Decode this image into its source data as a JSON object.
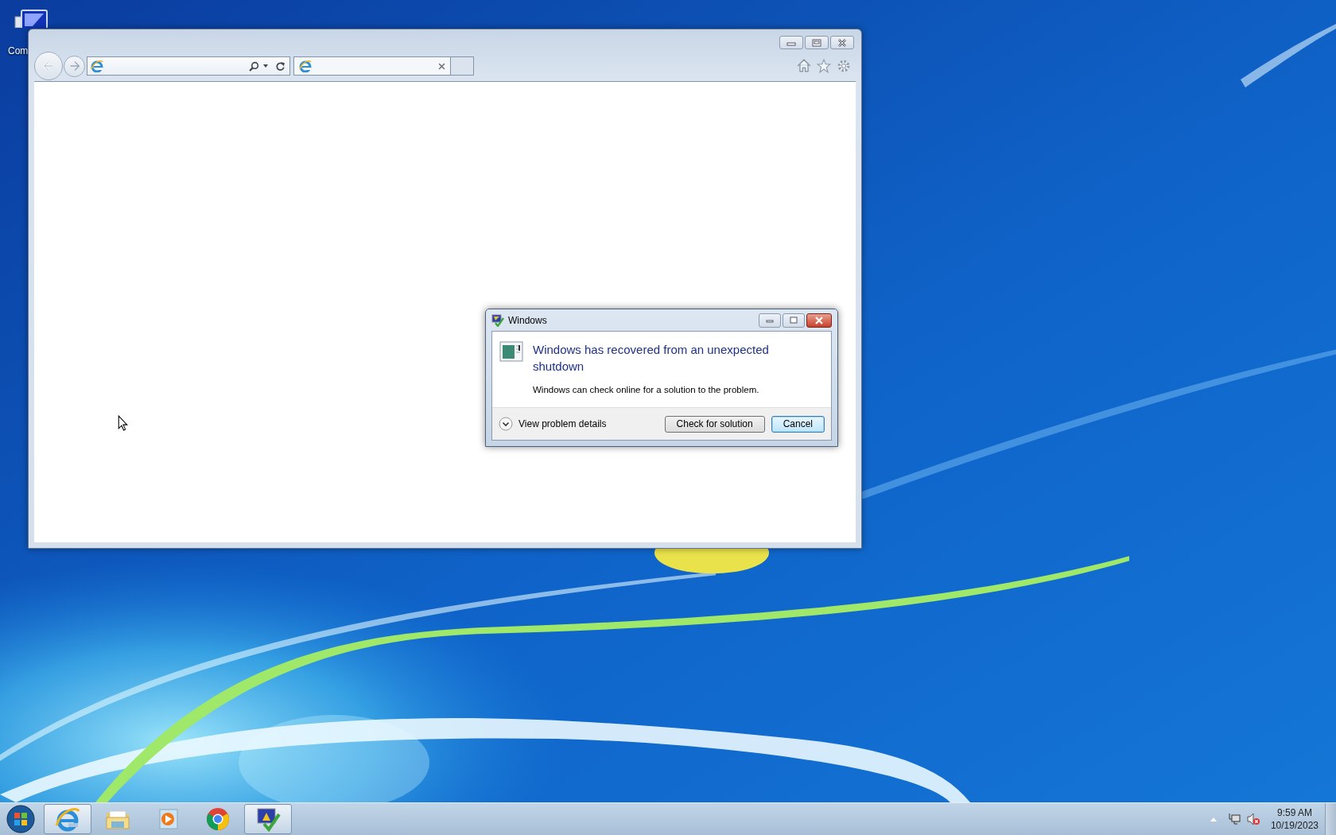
{
  "desktop": {
    "icons": [
      {
        "label": "Com"
      }
    ]
  },
  "dialog": {
    "title": "Windows",
    "heading": "Windows has recovered from an unexpected shutdown",
    "message": "Windows can check online for a solution to the problem.",
    "details_toggle": "View problem details",
    "buttons": [
      {
        "label": "Check for solution",
        "default": false
      },
      {
        "label": "Cancel",
        "default": true
      }
    ]
  },
  "taskbar": {
    "apps": [
      {
        "kind": "browser",
        "running": true
      },
      {
        "kind": "folder",
        "running": false
      },
      {
        "kind": "media",
        "running": false
      },
      {
        "kind": "chrome",
        "running": false
      },
      {
        "kind": "alert",
        "running": true
      }
    ],
    "volume": {
      "muted": true
    },
    "clock": {
      "time": "9:59 AM",
      "date": "10/19/2023"
    }
  }
}
